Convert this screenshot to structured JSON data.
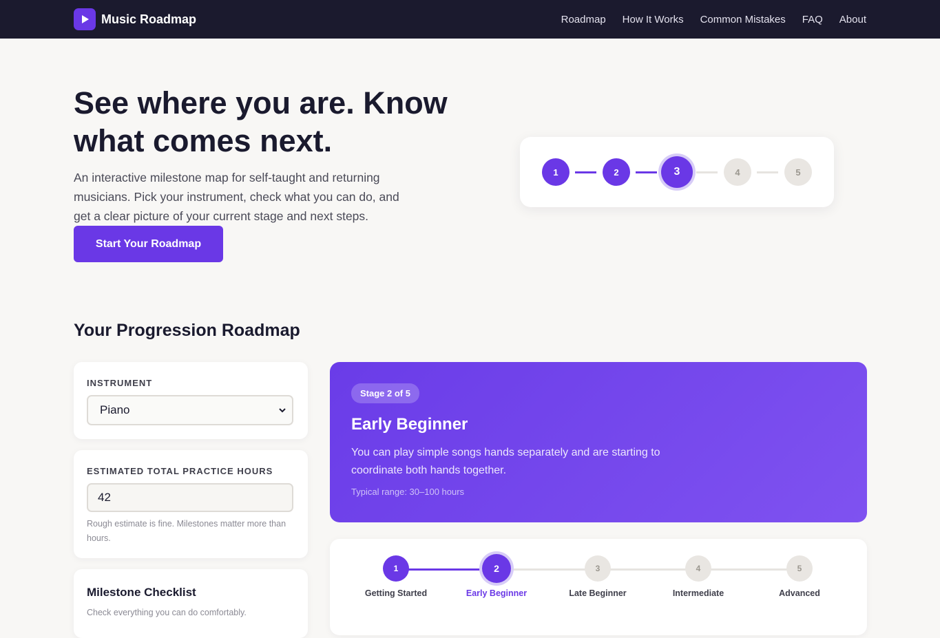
{
  "brand": {
    "name": "Music Roadmap",
    "logo_icon": "play-icon",
    "accent": "#6a38e6"
  },
  "nav": [
    {
      "label": "Roadmap"
    },
    {
      "label": "How It Works"
    },
    {
      "label": "Common Mistakes"
    },
    {
      "label": "FAQ"
    },
    {
      "label": "About"
    }
  ],
  "hero": {
    "title": "See where you are. Know what comes next.",
    "subtitle": "An interactive milestone map for self-taught and returning musicians. Pick your instrument, check what you can do, and get a clear picture of your current stage and next steps.",
    "cta_label": "Start Your Roadmap",
    "preview_steps": [
      {
        "num": "1",
        "state": "done"
      },
      {
        "num": "2",
        "state": "done"
      },
      {
        "num": "3",
        "state": "current"
      },
      {
        "num": "4",
        "state": "todo"
      },
      {
        "num": "5",
        "state": "todo"
      }
    ]
  },
  "roadmap": {
    "title": "Your Progression Roadmap",
    "instrument": {
      "label": "INSTRUMENT",
      "value": "Piano",
      "icon": "chevron-down-icon"
    },
    "hours": {
      "label": "ESTIMATED TOTAL PRACTICE HOURS",
      "value": "42",
      "hint": "Rough estimate is fine. Milestones matter more than hours."
    },
    "checklist": {
      "title": "Milestone Checklist",
      "description": "Check everything you can do comfortably."
    },
    "stage": {
      "badge": "Stage 2 of 5",
      "name": "Early Beginner",
      "description": "You can play simple songs hands separately and are starting to coordinate both hands together.",
      "range": "Typical range: 30–100 hours"
    },
    "track": [
      {
        "num": "1",
        "label": "Getting Started",
        "state": "done"
      },
      {
        "num": "2",
        "label": "Early Beginner",
        "state": "current"
      },
      {
        "num": "3",
        "label": "Late Beginner",
        "state": "todo"
      },
      {
        "num": "4",
        "label": "Intermediate",
        "state": "todo"
      },
      {
        "num": "5",
        "label": "Advanced",
        "state": "todo"
      }
    ]
  }
}
